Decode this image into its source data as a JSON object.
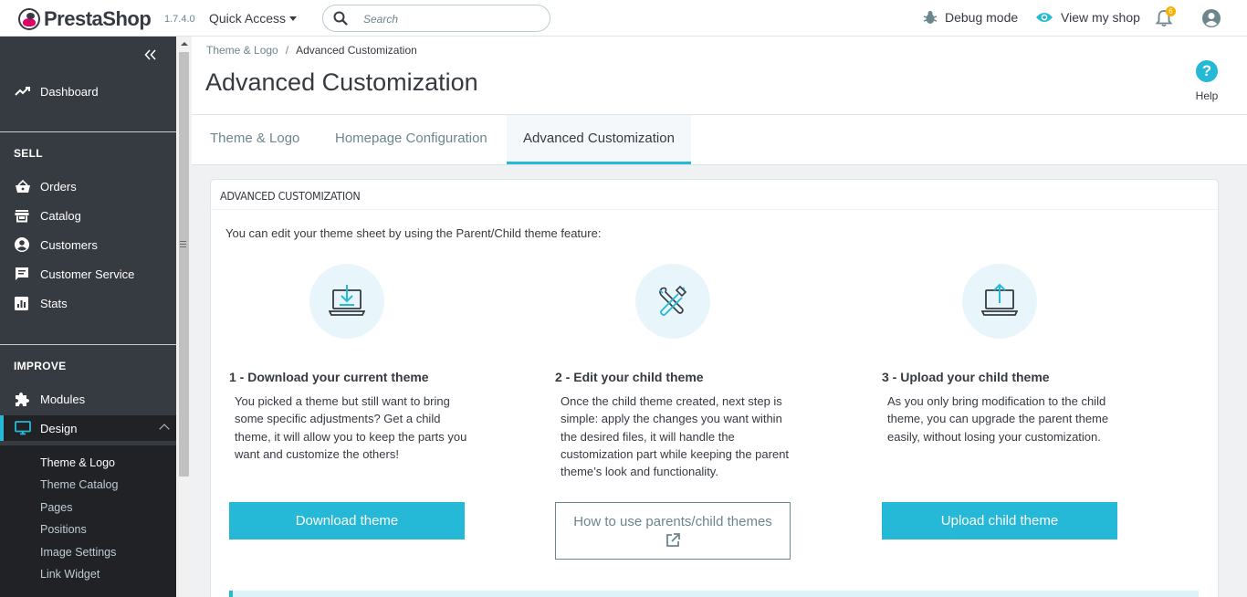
{
  "header": {
    "brand": "PrestaShop",
    "version": "1.7.4.0",
    "quick_access": "Quick Access",
    "search_placeholder": "Search",
    "debug_mode": "Debug mode",
    "view_shop": "View my shop",
    "notification_count": "6"
  },
  "sidebar": {
    "dashboard": "Dashboard",
    "sell_title": "SELL",
    "sell_items": [
      "Orders",
      "Catalog",
      "Customers",
      "Customer Service",
      "Stats"
    ],
    "improve_title": "IMPROVE",
    "modules": "Modules",
    "design": "Design",
    "design_sub": [
      "Theme & Logo",
      "Theme Catalog",
      "Pages",
      "Positions",
      "Image Settings",
      "Link Widget"
    ]
  },
  "page": {
    "breadcrumb": [
      "Theme & Logo",
      "Advanced Customization"
    ],
    "title": "Advanced Customization",
    "help": "Help",
    "tabs": [
      "Theme & Logo",
      "Homepage Configuration",
      "Advanced Customization"
    ]
  },
  "panel": {
    "heading": "ADVANCED CUSTOMIZATION",
    "intro": "You can edit your theme sheet by using the Parent/Child theme feature:",
    "steps": [
      {
        "title": "1 - Download your current theme",
        "text": "You picked a theme but still want to bring some specific adjustments? Get a child theme, it will allow you to keep the parts you want and customize the others!",
        "button": "Download theme",
        "icon": "laptop-download-icon"
      },
      {
        "title": "2 - Edit your child theme",
        "text": "Once the child theme created, next step is simple: apply the changes you want within the desired files, it will handle the customization part while keeping the parent theme’s look and functionality.",
        "button": "How to use parents/child themes",
        "icon": "tools-icon"
      },
      {
        "title": "3 - Upload your child theme",
        "text": "As you only bring modification to the child theme, you can upgrade the parent theme easily, without losing your customization.",
        "button": "Upload child theme",
        "icon": "laptop-upload-icon"
      }
    ]
  },
  "colors": {
    "primary": "#25b9d7",
    "sidebar_bg": "#363a41",
    "text": "#363a41",
    "muted": "#6c868e"
  }
}
